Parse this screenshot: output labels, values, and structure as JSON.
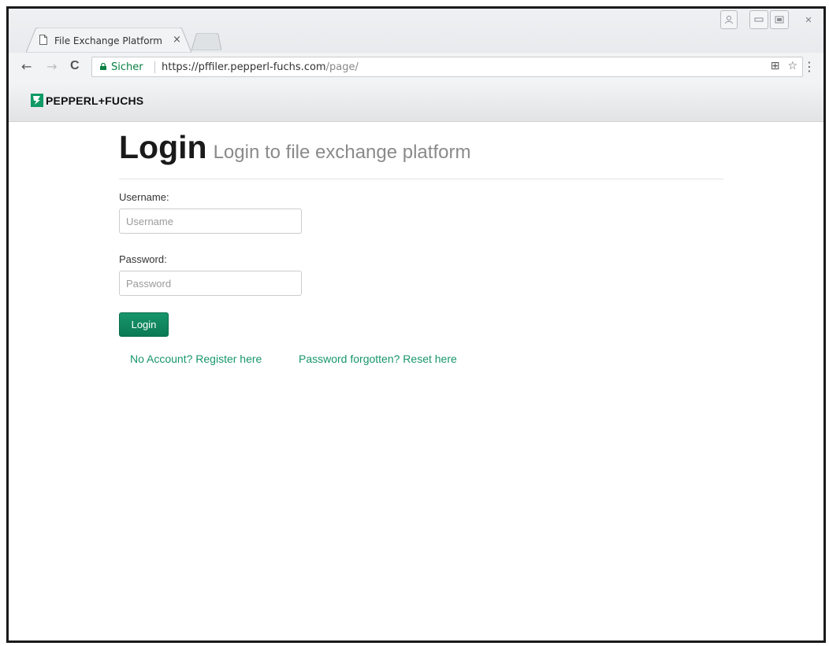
{
  "browser": {
    "tab_title": "File Exchange Platform",
    "tab_close": "×",
    "secure_label": "Sicher",
    "url_main": "https://pffiler.pepperl-fuchs.com",
    "url_path": "/page/",
    "nav": {
      "back": "←",
      "forward": "→",
      "reload": "C"
    },
    "omnibox_icons": {
      "translate": "⊞",
      "bookmark": "☆"
    },
    "menu": "⋮",
    "window_controls": {
      "profile": "⍝",
      "minimize": "▭",
      "maximize": "◘",
      "close": "✕"
    }
  },
  "site": {
    "logo_text": "PEPPERL+FUCHS",
    "brand_color": "#0f9a66"
  },
  "page": {
    "title": "Login",
    "subtitle": "Login to file exchange platform",
    "username_label": "Username:",
    "username_placeholder": "Username",
    "password_label": "Password:",
    "password_placeholder": "Password",
    "login_button": "Login",
    "register_link": "No Account? Register here",
    "reset_link": "Password forgotten? Reset here"
  }
}
